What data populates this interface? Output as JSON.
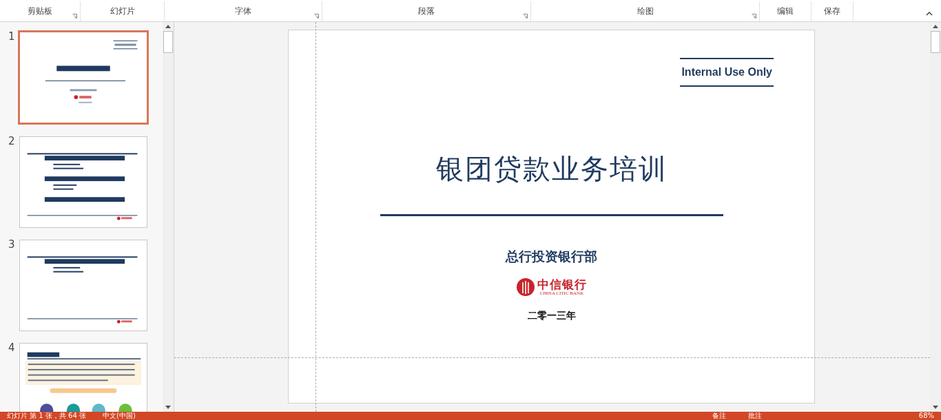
{
  "ribbon": {
    "groups": [
      {
        "label": "剪贴板",
        "launcher": true
      },
      {
        "label": "幻灯片",
        "launcher": false
      },
      {
        "label": "字体",
        "launcher": true
      },
      {
        "label": "段落",
        "launcher": true
      },
      {
        "label": "绘图",
        "launcher": true
      },
      {
        "label": "编辑",
        "launcher": false
      },
      {
        "label": "保存",
        "launcher": false
      }
    ]
  },
  "thumbnails": [
    {
      "number": "1",
      "selected": true,
      "kind": "title"
    },
    {
      "number": "2",
      "selected": false,
      "kind": "agenda"
    },
    {
      "number": "3",
      "selected": false,
      "kind": "section"
    },
    {
      "number": "4",
      "selected": false,
      "kind": "content"
    }
  ],
  "slide": {
    "tag": "Internal Use Only",
    "title": "银团贷款业务培训",
    "department": "总行投资银行部",
    "logo": {
      "name": "中信银行",
      "english": "CHINA CITIC BANK"
    },
    "year": "二零一三年"
  },
  "status_bar": {
    "slide_info": "幻灯片 第 1 张，共 64 张",
    "language": "中文(中国)",
    "notes": "备注",
    "comments": "批注",
    "zoom": "68%"
  }
}
